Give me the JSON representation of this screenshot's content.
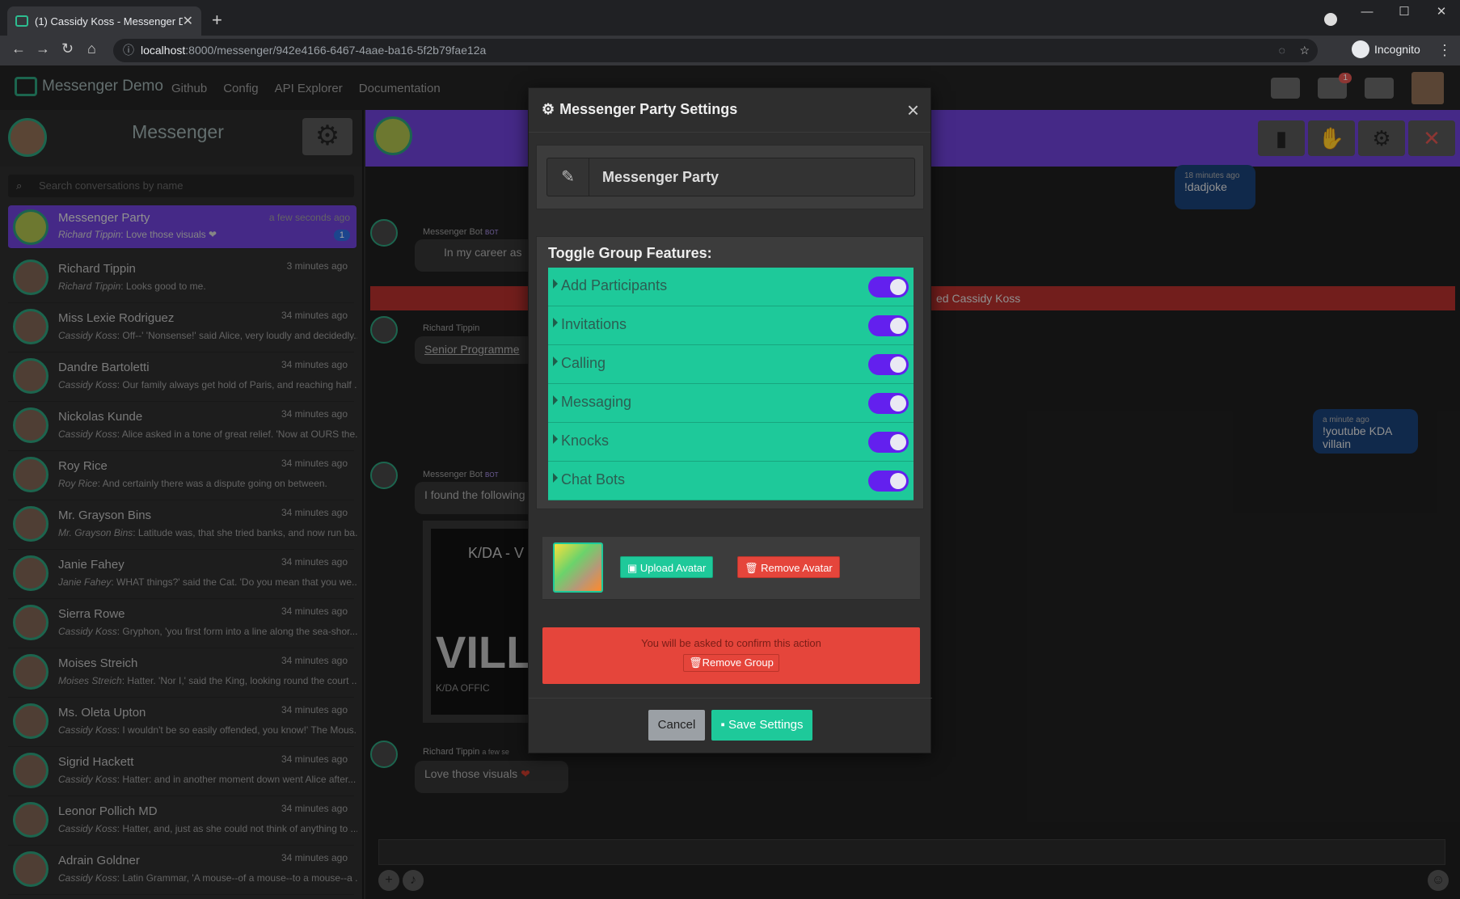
{
  "browser": {
    "tab_title": "(1) Cassidy Koss - Messenger De",
    "tab_close": "✕",
    "new_tab": "+",
    "url_host": "localhost",
    "url_path": ":8000/messenger/942e4166-6467-4aae-ba16-5f2b79fae12a",
    "incognito_label": "Incognito",
    "window_controls": [
      "—",
      "☐",
      "✕"
    ]
  },
  "appnav": {
    "brand": "Messenger Demo",
    "links": [
      "Github",
      "Config",
      "API Explorer",
      "Documentation"
    ],
    "notification_count": "1"
  },
  "sidebar": {
    "title": "Messenger",
    "search_placeholder": "Search conversations by name",
    "conversations": [
      {
        "name": "Messenger Party",
        "time": "a few seconds ago",
        "author": "Richard Tippin",
        "preview": ": Love those visuals ❤",
        "count": "1"
      },
      {
        "name": "Richard Tippin",
        "time": "3 minutes ago",
        "author": "Richard Tippin",
        "preview": ": Looks good to me."
      },
      {
        "name": "Miss Lexie Rodriguez",
        "time": "34 minutes ago",
        "author": "Cassidy Koss",
        "preview": ": Off--' 'Nonsense!' said Alice, very loudly and decidedly..."
      },
      {
        "name": "Dandre Bartoletti",
        "time": "34 minutes ago",
        "author": "Cassidy Koss",
        "preview": ": Our family always get hold of Paris, and reaching half ..."
      },
      {
        "name": "Nickolas Kunde",
        "time": "34 minutes ago",
        "author": "Cassidy Koss",
        "preview": ": Alice asked in a tone of great relief. 'Now at OURS the..."
      },
      {
        "name": "Roy Rice",
        "time": "34 minutes ago",
        "author": "Roy Rice",
        "preview": ": And certainly there was a dispute going on between."
      },
      {
        "name": "Mr. Grayson Bins",
        "time": "34 minutes ago",
        "author": "Mr. Grayson Bins",
        "preview": ": Latitude was, that she tried banks, and now run ba..."
      },
      {
        "name": "Janie Fahey",
        "time": "34 minutes ago",
        "author": "Janie Fahey",
        "preview": ": WHAT things?' said the Cat. 'Do you mean that you we..."
      },
      {
        "name": "Sierra Rowe",
        "time": "34 minutes ago",
        "author": "Cassidy Koss",
        "preview": ": Gryphon, 'you first form into a line along the sea-shor..."
      },
      {
        "name": "Moises Streich",
        "time": "34 minutes ago",
        "author": "Moises Streich",
        "preview": ": Hatter. 'Nor I,' said the King, looking round the court ..."
      },
      {
        "name": "Ms. Oleta Upton",
        "time": "34 minutes ago",
        "author": "Cassidy Koss",
        "preview": ": I wouldn't be so easily offended, you know!' The Mous..."
      },
      {
        "name": "Sigrid Hackett",
        "time": "34 minutes ago",
        "author": "Cassidy Koss",
        "preview": ": Hatter: and in another moment down went Alice after..."
      },
      {
        "name": "Leonor Pollich MD",
        "time": "34 minutes ago",
        "author": "Cassidy Koss",
        "preview": ": Hatter, and, just as she could not think of anything to ..."
      },
      {
        "name": "Adrain Goldner",
        "time": "34 minutes ago",
        "author": "Cassidy Koss",
        "preview": ": Latin Grammar, 'A mouse--of a mouse--to a mouse--a ..."
      }
    ]
  },
  "chat": {
    "msg_dadjoke": {
      "time": "18 minutes ago",
      "text": "!dadjoke"
    },
    "bot_name": "Messenger Bot",
    "bot_tag": "BOT",
    "bot_msg1": "In my career as",
    "redbar_text": "ed Cassidy Koss",
    "richard_name": "Richard Tippin",
    "richard_link": "Senior Programme",
    "msg_youtube": {
      "time": "a minute ago",
      "text": "!youtube KDA villain"
    },
    "bot_msg2": "I found the following",
    "yt_title": "K/DA - V",
    "yt_big": "VILLA",
    "yt_small": "K/DA   OFFIC",
    "richard_time": "a few se",
    "richard_msg": "Love those visuals"
  },
  "modal": {
    "title": "Messenger Party Settings",
    "close": "×",
    "group_name": "Messenger Party",
    "features_title": "Toggle Group Features:",
    "features": [
      {
        "label": "Add Participants",
        "on": true
      },
      {
        "label": "Invitations",
        "on": true
      },
      {
        "label": "Calling",
        "on": true
      },
      {
        "label": "Messaging",
        "on": true
      },
      {
        "label": "Knocks",
        "on": true
      },
      {
        "label": "Chat Bots",
        "on": true
      }
    ],
    "upload_avatar": "Upload Avatar",
    "remove_avatar": "Remove Avatar",
    "confirm_note": "You will be asked to confirm this action",
    "remove_group": "Remove Group",
    "cancel": "Cancel",
    "save": "Save Settings"
  },
  "colors": {
    "accent_purple": "#6b3fd0",
    "feature_green": "#1ec99a",
    "toggle_on": "#6320ee",
    "danger_red": "#e5453b"
  }
}
